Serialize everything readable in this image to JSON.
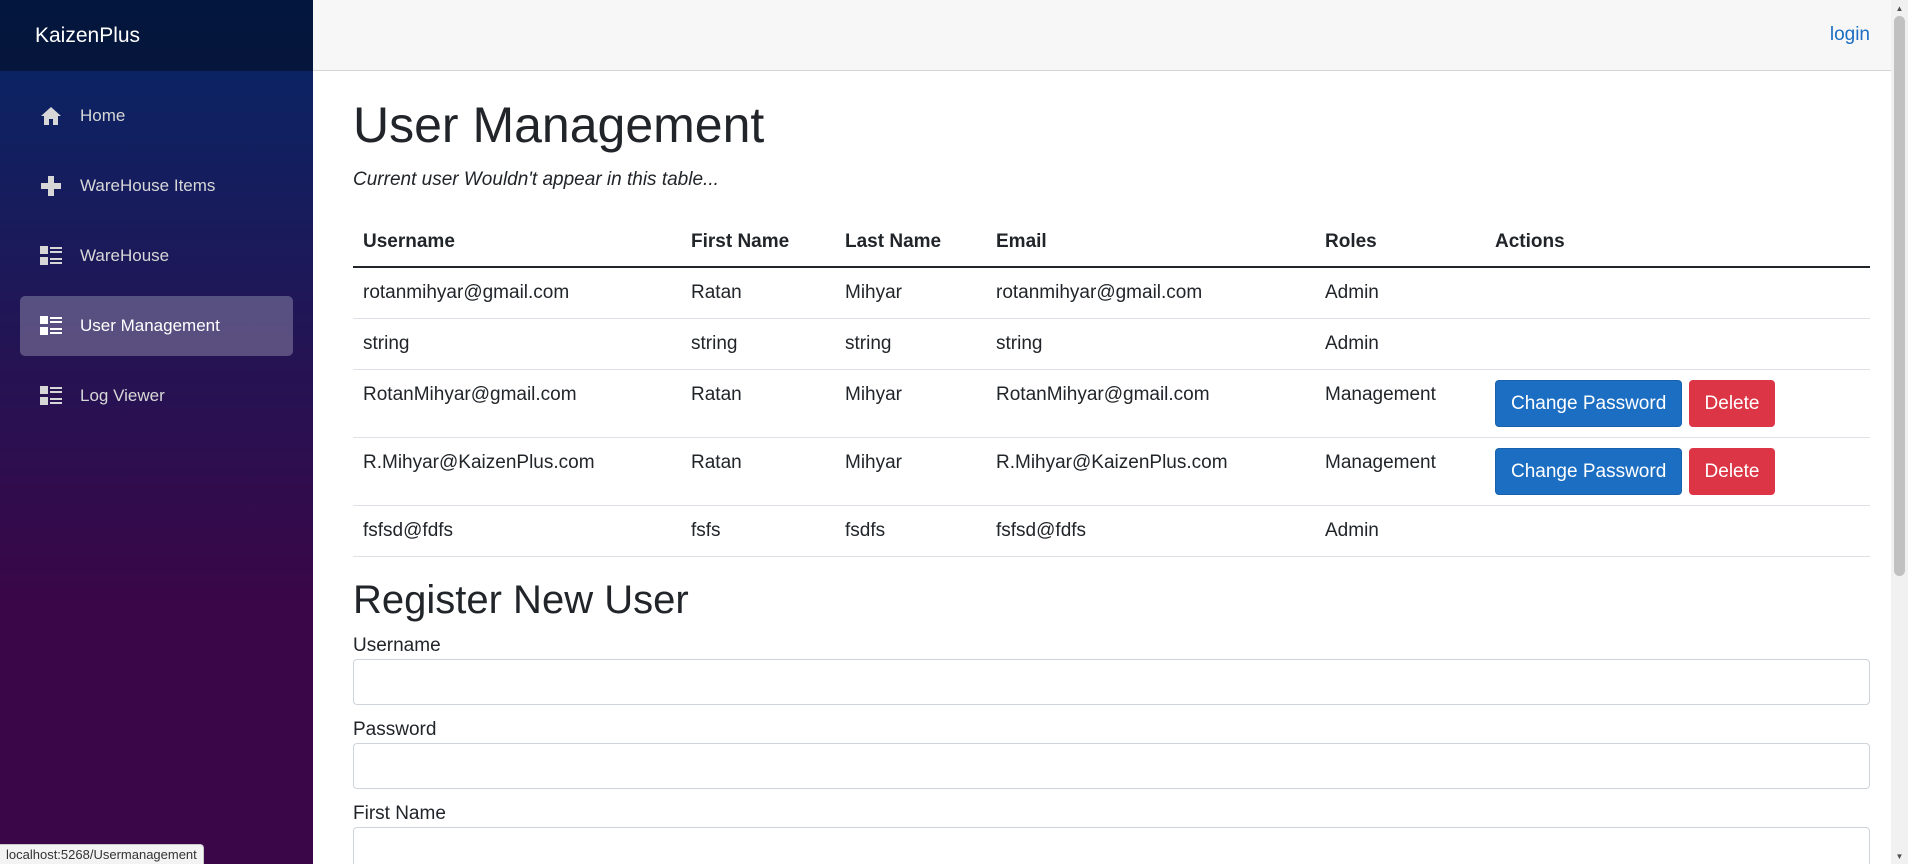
{
  "sidebar": {
    "brand": "KaizenPlus",
    "items": [
      {
        "label": "Home",
        "icon": "home-icon",
        "active": false
      },
      {
        "label": "WareHouse Items",
        "icon": "plus-icon",
        "active": false
      },
      {
        "label": "WareHouse",
        "icon": "list-rich-icon",
        "active": false
      },
      {
        "label": "User Management",
        "icon": "list-rich-icon",
        "active": true
      },
      {
        "label": "Log Viewer",
        "icon": "list-rich-icon",
        "active": false
      }
    ]
  },
  "header": {
    "login_label": "login"
  },
  "main": {
    "title": "User Management",
    "subtitle": "Current user Wouldn't appear in this table...",
    "table": {
      "columns": [
        "Username",
        "First Name",
        "Last Name",
        "Email",
        "Roles",
        "Actions"
      ],
      "rows": [
        {
          "username": "rotanmihyar@gmail.com",
          "first_name": "Ratan",
          "last_name": "Mihyar",
          "email": "rotanmihyar@gmail.com",
          "roles": "Admin",
          "change_password": "",
          "delete": ""
        },
        {
          "username": "string",
          "first_name": "string",
          "last_name": "string",
          "email": "string",
          "roles": "Admin",
          "change_password": "",
          "delete": ""
        },
        {
          "username": "RotanMihyar@gmail.com",
          "first_name": "Ratan",
          "last_name": "Mihyar",
          "email": "RotanMihyar@gmail.com",
          "roles": "Management",
          "change_password": "Change Password",
          "delete": "Delete"
        },
        {
          "username": "R.Mihyar@KaizenPlus.com",
          "first_name": "Ratan",
          "last_name": "Mihyar",
          "email": "R.Mihyar@KaizenPlus.com",
          "roles": "Management",
          "change_password": "Change Password",
          "delete": "Delete"
        },
        {
          "username": "fsfsd@fdfs",
          "first_name": "fsfs",
          "last_name": "fsdfs",
          "email": "fsfsd@fdfs",
          "roles": "Admin",
          "change_password": "",
          "delete": ""
        }
      ]
    },
    "register": {
      "title": "Register New User",
      "fields": [
        {
          "label": "Username",
          "value": ""
        },
        {
          "label": "Password",
          "value": ""
        },
        {
          "label": "First Name",
          "value": ""
        }
      ]
    }
  },
  "status_bar": {
    "url": "localhost:5268/Usermanagement"
  },
  "colors": {
    "primary": "#1b6ec2",
    "danger": "#dc3545",
    "sidebar_top": "#052767",
    "sidebar_bottom": "#3a0647"
  }
}
